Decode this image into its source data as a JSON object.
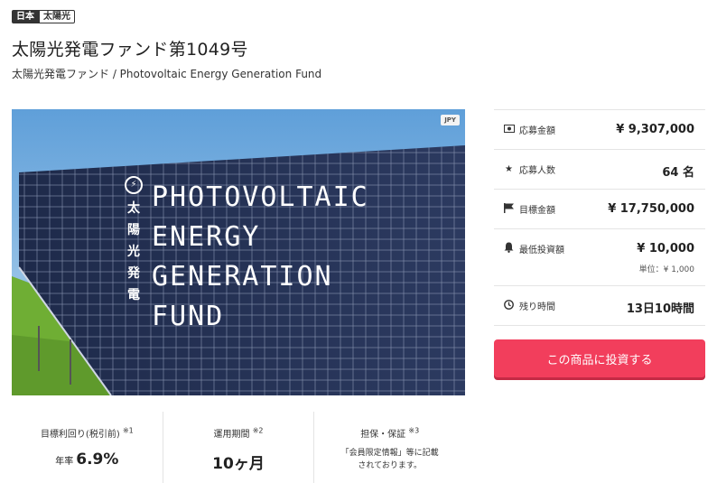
{
  "tags": {
    "country": "日本",
    "category": "太陽光"
  },
  "title": "太陽光発電ファンド第1049号",
  "subtitle": "太陽光発電ファンド / Photovoltaic Energy Generation Fund",
  "hero": {
    "currency_badge": "JPY",
    "vertical_text": [
      "太",
      "陽",
      "光",
      "発",
      "電"
    ],
    "title_lines": [
      "PHOTOVOLTAIC",
      "ENERGY",
      "GENERATION",
      "FUND"
    ]
  },
  "panel": {
    "applied_amount": {
      "label": "応募金額",
      "value": "¥ 9,307,000",
      "icon": "money-icon"
    },
    "applicants": {
      "label": "応募人数",
      "value": "64 名",
      "icon": "star-icon"
    },
    "target_amount": {
      "label": "目標金額",
      "value": "¥ 17,750,000",
      "icon": "flag-icon"
    },
    "min_investment": {
      "label": "最低投資額",
      "value": "¥ 10,000",
      "unit": "単位：¥ 1,000",
      "icon": "bell-icon"
    },
    "time_left": {
      "label": "残り時間",
      "value": "13日10時間",
      "icon": "clock-icon"
    }
  },
  "invest_button": "この商品に投資する",
  "stats": {
    "yield": {
      "label": "目標利回り(税引前)",
      "note": "※1",
      "prefix": "年率",
      "value": "6.9%"
    },
    "period": {
      "label": "運用期間",
      "note": "※2",
      "value": "10ヶ月"
    },
    "collateral": {
      "label": "担保・保証",
      "note": "※3",
      "text_line1": "「会員限定情報」等に記載",
      "text_line2": "されております。"
    }
  },
  "colors": {
    "accent": "#f23e5c",
    "text": "#333333",
    "border": "#e4e4e4",
    "sky": "#7fb4e3",
    "grass": "#5f9a2c"
  }
}
